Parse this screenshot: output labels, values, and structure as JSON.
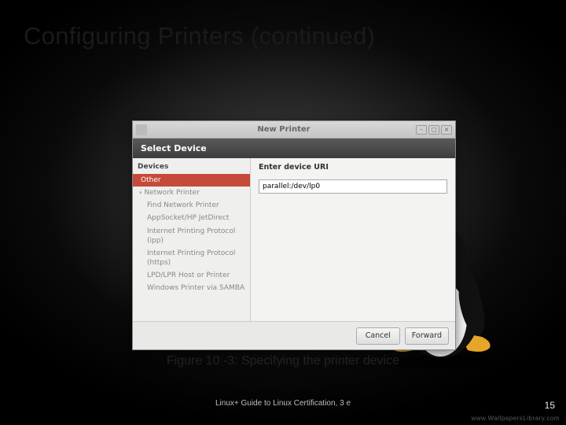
{
  "slide": {
    "title": "Configuring Printers (continued)",
    "caption": "Figure 10 -3: Specifying the printer device",
    "footer": "Linux+ Guide to Linux Certification, 3 e",
    "page": "15",
    "watermark": "www.WallpapersLibrary.com"
  },
  "window": {
    "title": "New Printer",
    "header": "Select Device",
    "left_header": "Devices",
    "items": {
      "other": "Other",
      "network": "Network Printer",
      "find": "Find Network Printer",
      "appsocket": "AppSocket/HP JetDirect",
      "ipp": "Internet Printing Protocol (ipp)",
      "https": "Internet Printing Protocol (https)",
      "lpd": "LPD/LPR Host or Printer",
      "samba": "Windows Printer via SAMBA"
    },
    "right_label": "Enter device URI",
    "uri_value": "parallel:/dev/lp0",
    "buttons": {
      "cancel": "Cancel",
      "forward": "Forward"
    }
  }
}
